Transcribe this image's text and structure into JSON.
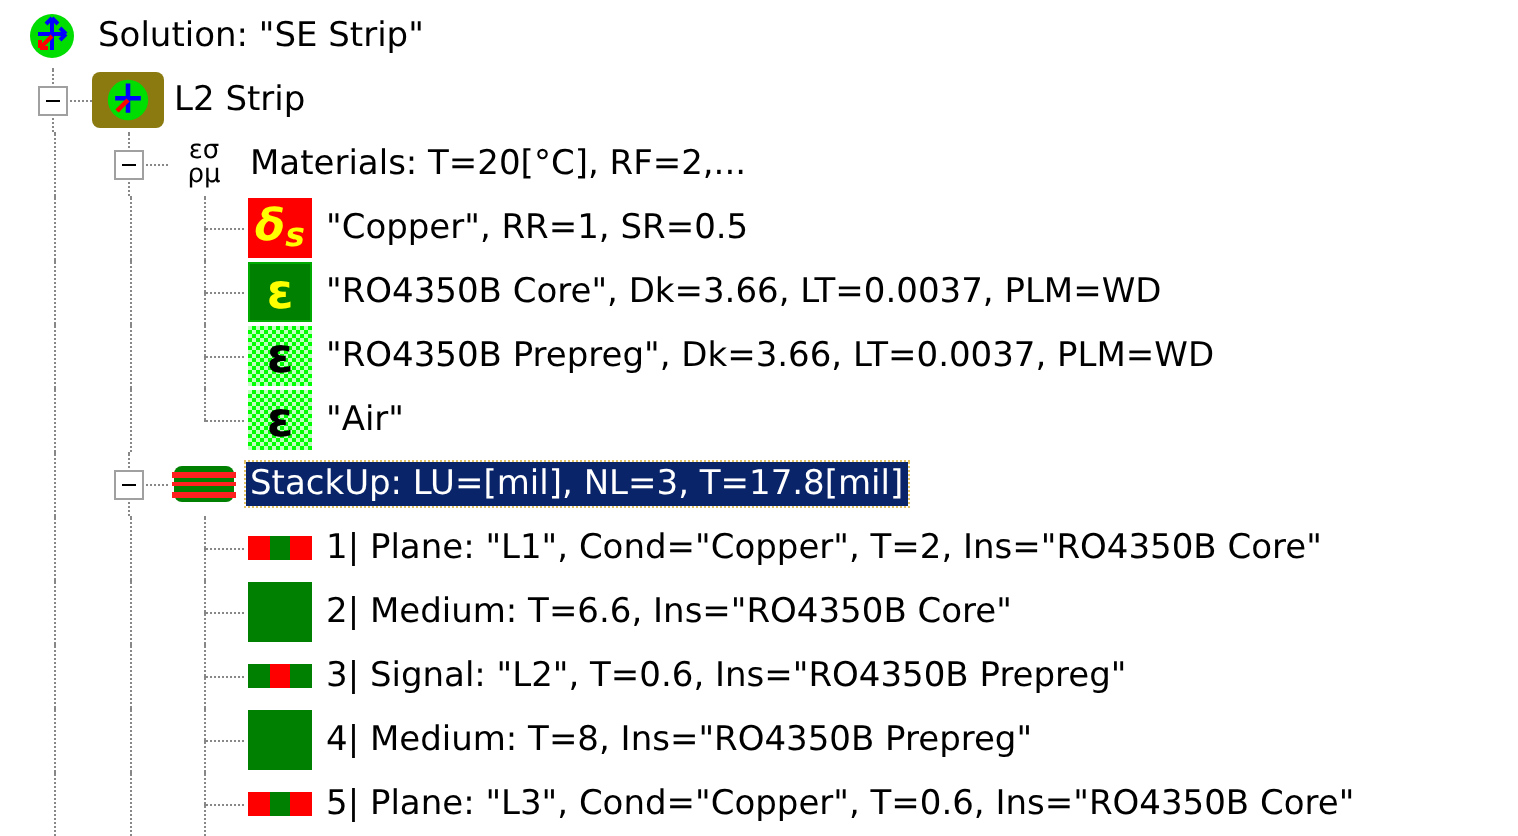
{
  "tree": {
    "label": "Solution: \"SE Strip\"",
    "kind": "solution",
    "selected": false,
    "children": [
      {
        "label": "L2 Strip",
        "kind": "folder",
        "expanded": true,
        "selected": false,
        "children": [
          {
            "label": "Materials: T=20[°C], RF=2,...",
            "kind": "materials",
            "symbol": [
              "εσ",
              "ρμ"
            ],
            "expanded": true,
            "selected": false,
            "children": [
              {
                "label": "\"Copper\", RR=1, SR=0.5",
                "kind": "conductor",
                "symbol": "δ$_{s}$",
                "selected": false
              },
              {
                "label": "\"RO4350B Core\", Dk=3.66, LT=0.0037, PLM=WD",
                "kind": "dielectric",
                "symbol": "ε",
                "selected": false
              },
              {
                "label": "\"RO4350B Prepreg\", Dk=3.66, LT=0.0037, PLM=WD",
                "kind": "prepreg",
                "symbol": "ε",
                "selected": false
              },
              {
                "label": "\"Air\"",
                "kind": "prepreg",
                "symbol": "ε",
                "selected": false
              }
            ]
          },
          {
            "label": "StackUp: LU=[mil], NL=3, T=17.8[mil]",
            "kind": "stackup",
            "expanded": true,
            "selected": true,
            "children": [
              {
                "label": "1| Plane: \"L1\", Cond=\"Copper\", T=2, Ins=\"RO4350B Core\"",
                "kind": "plane",
                "selected": false
              },
              {
                "label": "2| Medium: T=6.6, Ins=\"RO4350B Core\"",
                "kind": "medium",
                "selected": false
              },
              {
                "label": "3| Signal: \"L2\", T=0.6, Ins=\"RO4350B Prepreg\"",
                "kind": "signal",
                "selected": false
              },
              {
                "label": "4| Medium: T=8, Ins=\"RO4350B Prepreg\"",
                "kind": "medium",
                "selected": false
              },
              {
                "label": "5| Plane: \"L3\", Cond=\"Copper\", T=0.6, Ins=\"RO4350B Core\"",
                "kind": "plane",
                "selected": false
              }
            ]
          }
        ]
      }
    ]
  }
}
